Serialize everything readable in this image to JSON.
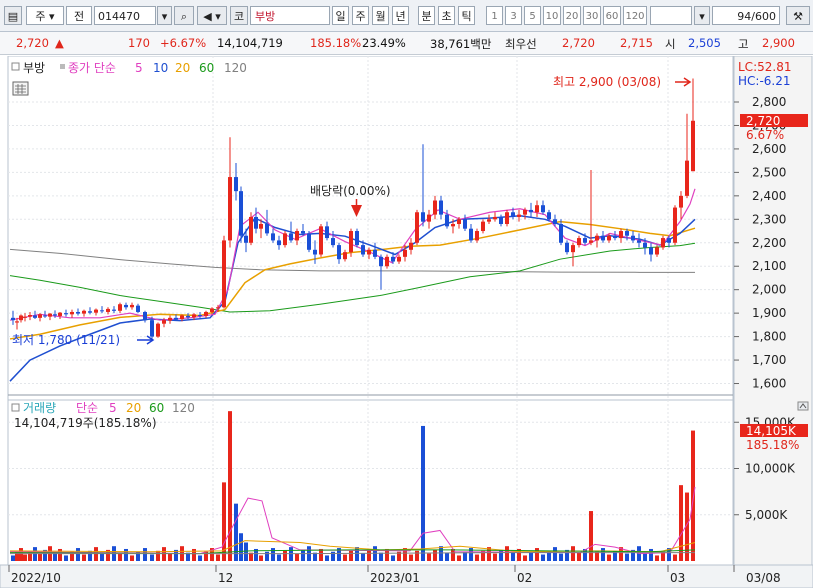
{
  "toolbar": {
    "market_label": "주",
    "whole_label": "전",
    "code": "014470",
    "market_tag": "코",
    "name": "부방",
    "periods": [
      "일",
      "주",
      "월",
      "년",
      "분",
      "초",
      "틱"
    ],
    "active_period": "일",
    "intervals": [
      "1",
      "3",
      "5",
      "10",
      "20",
      "30",
      "60",
      "120"
    ],
    "count_value": "94",
    "count_total": "/600"
  },
  "quote": {
    "price": "2,720",
    "direction_arrow": "▲",
    "change": "170",
    "change_pct": "+6.67%",
    "volume": "14,104,719",
    "volume_ratio": "185.18%",
    "turnover": "23.49%",
    "amount": "38,761백만",
    "best_ask_label": "최우선",
    "best_ask": "2,720",
    "best_bid": "2,715",
    "open_label": "시",
    "open": "2,505",
    "high_label": "고",
    "high": "2,900"
  },
  "price_pane": {
    "legend_name": "부방",
    "legend_ma_label": "종가 단순",
    "ma_periods": [
      "5",
      "10",
      "20",
      "60",
      "120"
    ],
    "ma_colors": [
      "#e040c0",
      "#1f4fd0",
      "#e8a000",
      "#1a9a1a",
      "#808080"
    ],
    "lc_label": "LC:52.81",
    "hc_label": "HC:-6.21",
    "high_annotation": "최고 2,900 (03/08)",
    "low_annotation": "최저 1,780 (11/21)",
    "dividend_annotation": "배당락(0.00%)",
    "current_price_tag": "2,720",
    "current_pct_tag": "6.67%",
    "y_ticks": [
      "2,800",
      "2,700",
      "2,600",
      "2,500",
      "2,400",
      "2,300",
      "2,200",
      "2,100",
      "2,000",
      "1,900",
      "1,800",
      "1,700",
      "1,600"
    ]
  },
  "volume_pane": {
    "legend_name": "거래량",
    "legend_ma_label": "단순",
    "ma_periods": [
      "5",
      "20",
      "60",
      "120"
    ],
    "current_volume_text": "14,104,719주(185.18%)",
    "current_volume_tag": "14,105K",
    "current_ratio_tag": "185.18%",
    "y_ticks": [
      "15,000K",
      "10,000K",
      "5,000K"
    ]
  },
  "x_axis": {
    "labels": [
      "2022/10",
      "12",
      "2023/01",
      "02",
      "03",
      "03/08"
    ]
  },
  "colors": {
    "up": "#e8261b",
    "down": "#1a4fd6",
    "annotation_red": "#e0261b",
    "annotation_blue": "#1a3fd6"
  },
  "chart_data": {
    "type": "candlestick",
    "price_y_range": [
      1550,
      2950
    ],
    "volume_y_range": [
      0,
      17500000
    ],
    "low": {
      "value": 1780,
      "date": "11/21"
    },
    "high": {
      "value": 2900,
      "date": "03/08"
    },
    "last": {
      "open": 2505,
      "high": 2900,
      "low": 2505,
      "close": 2720,
      "volume": 14104719
    }
  }
}
